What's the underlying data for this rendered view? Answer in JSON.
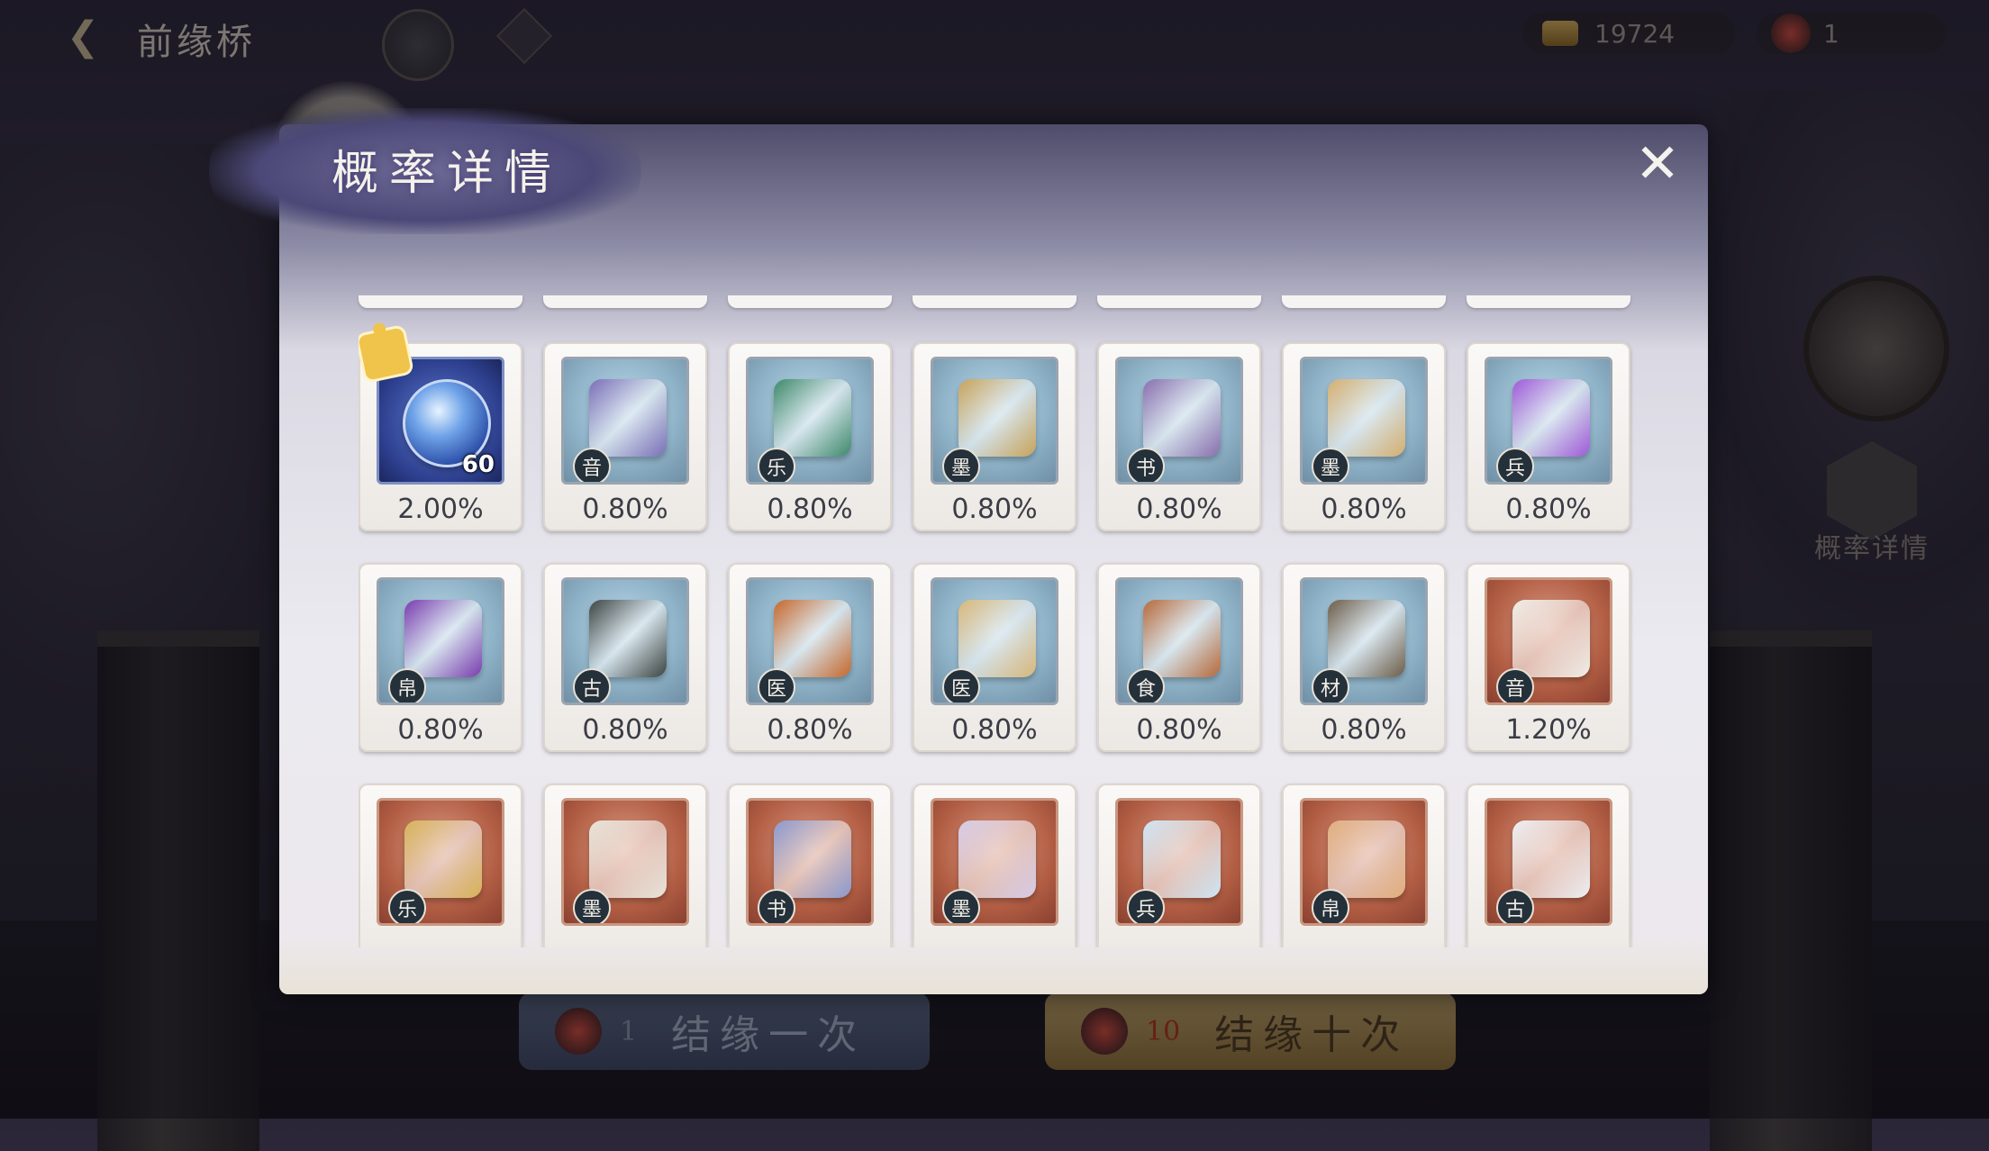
{
  "screen_title": "前缘桥",
  "currencies": {
    "gold": "19724",
    "tickets": "1"
  },
  "side": {
    "prob_label": "概率详情"
  },
  "buttons": {
    "single": {
      "count": "1",
      "label": "结缘一次"
    },
    "ten": {
      "count": "10",
      "label": "结缘十次"
    }
  },
  "modal": {
    "title": "概率详情",
    "close_icon": "close-x-icon"
  },
  "items": [
    {
      "tag": "",
      "rate": "2.00%",
      "count": "60",
      "frame": "royal",
      "art_color": "#3f6fd0",
      "icon": "water-orb-icon",
      "puzzle": true
    },
    {
      "tag": "音",
      "rate": "0.80%",
      "frame": "blue",
      "art_color": "#7b6fb8",
      "icon": "music-score-book-icon"
    },
    {
      "tag": "乐",
      "rate": "0.80%",
      "frame": "blue",
      "art_color": "#3e8a6a",
      "icon": "jade-flute-icon"
    },
    {
      "tag": "墨",
      "rate": "0.80%",
      "frame": "blue",
      "art_color": "#c9a45a",
      "icon": "painting-scroll-icon"
    },
    {
      "tag": "书",
      "rate": "0.80%",
      "frame": "blue",
      "art_color": "#8a6fae",
      "icon": "calligraphy-scrolls-icon"
    },
    {
      "tag": "墨",
      "rate": "0.80%",
      "frame": "blue",
      "art_color": "#d6b070",
      "icon": "hanging-scroll-icon"
    },
    {
      "tag": "兵",
      "rate": "0.80%",
      "frame": "blue",
      "art_color": "#a05ad8",
      "icon": "purple-crystal-icon"
    },
    {
      "tag": "帛",
      "rate": "0.80%",
      "frame": "blue",
      "art_color": "#7a3cb0",
      "icon": "silk-bolt-icon"
    },
    {
      "tag": "古",
      "rate": "0.80%",
      "frame": "blue",
      "art_color": "#3e4542",
      "icon": "bronze-vessel-icon"
    },
    {
      "tag": "医",
      "rate": "0.80%",
      "frame": "blue",
      "art_color": "#c7682a",
      "icon": "medical-book-icon"
    },
    {
      "tag": "医",
      "rate": "0.80%",
      "frame": "blue",
      "art_color": "#d9b87a",
      "icon": "ginseng-root-icon"
    },
    {
      "tag": "食",
      "rate": "0.80%",
      "frame": "blue",
      "art_color": "#b86a3a",
      "icon": "roast-pig-icon"
    },
    {
      "tag": "材",
      "rate": "0.80%",
      "frame": "blue",
      "art_color": "#6e5d48",
      "icon": "seed-pod-icon"
    },
    {
      "tag": "音",
      "rate": "1.20%",
      "frame": "red",
      "art_color": "#f0eee8",
      "icon": "music-score-book-icon"
    },
    {
      "tag": "乐",
      "rate": "",
      "frame": "red",
      "art_color": "#d8b45a",
      "icon": "zither-icon"
    },
    {
      "tag": "墨",
      "rate": "",
      "frame": "red",
      "art_color": "#e8e4da",
      "icon": "painting-scroll-icon"
    },
    {
      "tag": "书",
      "rate": "",
      "frame": "red",
      "art_color": "#8c9ad0",
      "icon": "calligraphy-scrolls-icon"
    },
    {
      "tag": "墨",
      "rate": "",
      "frame": "red",
      "art_color": "#d8cce8",
      "icon": "hanging-scroll-icon"
    },
    {
      "tag": "兵",
      "rate": "",
      "frame": "red",
      "art_color": "#cfe6f5",
      "icon": "ice-crystal-icon"
    },
    {
      "tag": "帛",
      "rate": "",
      "frame": "red",
      "art_color": "#e2b080",
      "icon": "silk-bolt-icon"
    },
    {
      "tag": "古",
      "rate": "",
      "frame": "red",
      "art_color": "#eef0f4",
      "icon": "porcelain-vase-icon"
    }
  ]
}
